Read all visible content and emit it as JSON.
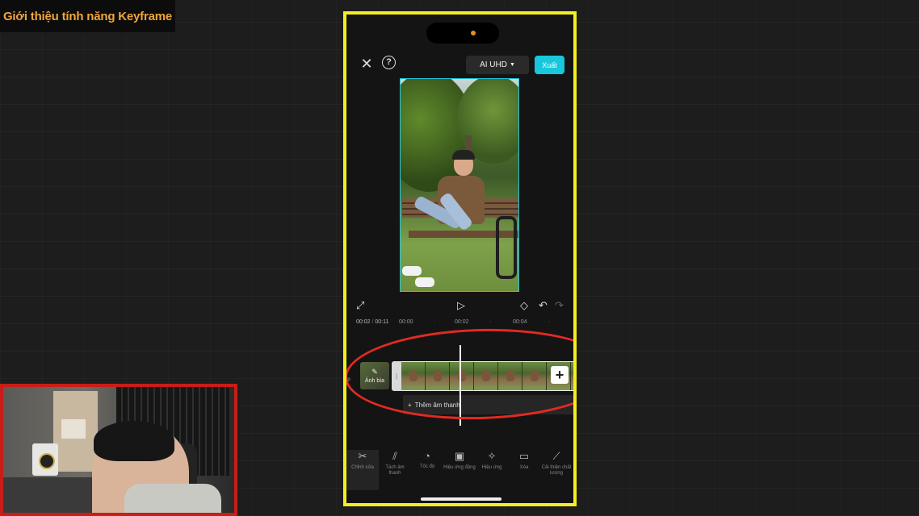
{
  "banner": {
    "title": "Giới thiệu tính năng Keyframe"
  },
  "colors": {
    "phone_frame": "#f4ee1f",
    "accent": "#19c7dc",
    "annotation": "#e32a22",
    "banner_text": "#f0a53a",
    "webcam_frame": "#c81d18"
  },
  "editor": {
    "top_bar": {
      "close_icon": "close-icon",
      "help_icon": "help-icon",
      "help_glyph": "?",
      "quality_label": "AI UHD",
      "export_label": "Xuất"
    },
    "preview_controls": {
      "fullscreen_icon": "fullscreen-icon",
      "play_icon": "play-icon",
      "keyframe_icon": "keyframe-icon",
      "undo_icon": "undo-icon",
      "redo_icon": "redo-icon"
    },
    "timecode": {
      "current": "00:02",
      "separator": "/",
      "total": "00:11"
    },
    "ruler": [
      "00:00",
      "00:02",
      "00:04"
    ],
    "timeline": {
      "cover_label": "Ảnh bìa",
      "side_label": "lp",
      "add_clip_glyph": "+",
      "add_audio_label": "Thêm âm thanh"
    },
    "toolbar": [
      {
        "name": "edit",
        "icon": "scissors-icon",
        "label": "Chỉnh sửa",
        "active": true
      },
      {
        "name": "split-sound",
        "icon": "split-audio-icon",
        "label": "Tách âm thanh"
      },
      {
        "name": "speed",
        "icon": "speed-icon",
        "label": "Tốc độ"
      },
      {
        "name": "motion-effects",
        "icon": "motion-effect-icon",
        "label": "Hiệu ứng động"
      },
      {
        "name": "effects",
        "icon": "sparkle-icon",
        "label": "Hiệu ứng"
      },
      {
        "name": "delete",
        "icon": "delete-icon",
        "label": "Xóa"
      },
      {
        "name": "enhance",
        "icon": "magic-wand-icon",
        "label": "Cải thiện chất lượng"
      }
    ]
  }
}
